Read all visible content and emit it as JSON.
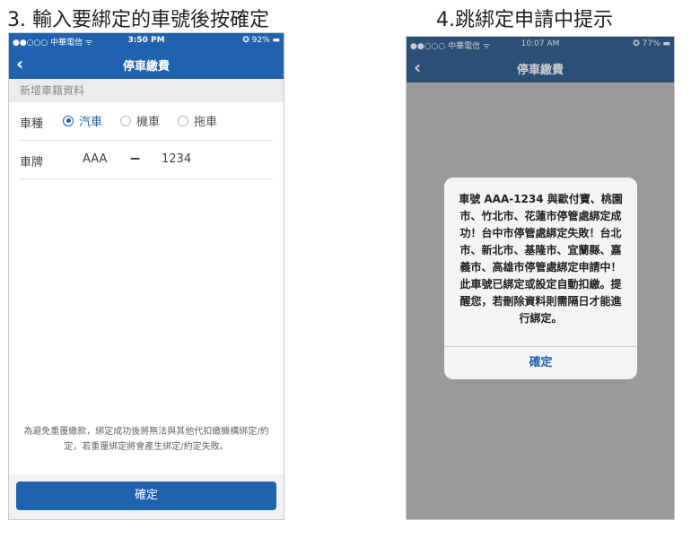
{
  "captions": {
    "left": "3. 輸入要綁定的車號後按確定",
    "right": "4.跳綁定申請中提示"
  },
  "left_phone": {
    "status": {
      "carrier": "●●○○○ 中華電信 ᯤ",
      "time": "3:50 PM",
      "battery": "✪ 92% ▬"
    },
    "nav": {
      "title": "停車繳費"
    },
    "section_header": "新增車籍資料",
    "vehicle_type": {
      "label": "車種",
      "options": [
        {
          "label": "汽車",
          "checked": true
        },
        {
          "label": "機車",
          "checked": false
        },
        {
          "label": "拖車",
          "checked": false
        }
      ]
    },
    "plate": {
      "label": "車牌",
      "prefix": "AAA",
      "dash": "−",
      "number": "1234"
    },
    "footnote": "為避免重覆繳款，綁定成功後將無法與其他代扣繳機構綁定/約定，若重覆綁定將會產生綁定/約定失敗。",
    "confirm_label": "確定"
  },
  "right_phone": {
    "status": {
      "carrier": "●●○○○ 中華電信 ᯤ",
      "time": "10:07 AM",
      "battery": "✪ 77% ▬"
    },
    "nav": {
      "title": "停車繳費"
    },
    "alert": {
      "message": "車號 AAA-1234 與歐付寶、桃園市、竹北市、花蓮市停管處綁定成功！台中市停管處綁定失敗！台北市、新北市、基隆市、宜蘭縣、嘉義市、高雄市停管處綁定申請中！此車號已綁定或設定自動扣繳。提醒您，若刪除資料則需隔日才能進行綁定。",
      "button_label": "確定"
    }
  },
  "colors": {
    "brand_blue": "#1f62ad",
    "dim_overlay": "#9a9a9a"
  },
  "icons": {
    "back": "chevron-left-icon"
  }
}
